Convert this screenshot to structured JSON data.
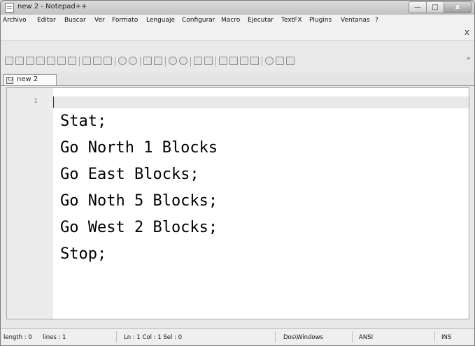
{
  "window": {
    "title": "new  2 - Notepad++",
    "controls": {
      "minimize": "—",
      "maximize": "□",
      "close": "x"
    }
  },
  "menu": {
    "items": [
      "Archivo",
      "Editar",
      "Buscar",
      "Ver",
      "Formato",
      "Lenguaje",
      "Configurar",
      "Macro",
      "Ejecutar",
      "TextFX",
      "Plugins",
      "Ventanas",
      "?"
    ],
    "close_document": "X"
  },
  "toolbar": {
    "icons": [
      "new-file-icon",
      "open-file-icon",
      "save-icon",
      "save-all-icon",
      "close-icon",
      "close-all-icon",
      "print-icon",
      "cut-icon",
      "copy-icon",
      "paste-icon",
      "undo-icon",
      "redo-icon",
      "find-icon",
      "replace-icon",
      "zoom-in-icon",
      "zoom-out-icon",
      "sync-vertical-icon",
      "sync-horizontal-icon",
      "word-wrap-icon",
      "show-all-characters-icon",
      "indent-guide-icon",
      "doc-map-icon",
      "record-macro-icon",
      "stop-macro-icon",
      "play-macro-icon"
    ],
    "overflow": "»"
  },
  "tabs": [
    {
      "label": "new 2",
      "icon": "save-icon"
    }
  ],
  "editor": {
    "line_numbers": [
      "1"
    ],
    "lines": [
      "Stat;",
      "Go North 1 Blocks",
      "Go East Blocks;",
      "Go Noth 5 Blocks;",
      "Go West 2 Blocks;",
      "Stop;"
    ]
  },
  "status": {
    "length": "length : 0",
    "lines": "lines : 1",
    "position": "Ln : 1   Col : 1   Sel : 0",
    "eol": "Dos\\Windows",
    "encoding": "ANSI",
    "mode": "INS"
  }
}
